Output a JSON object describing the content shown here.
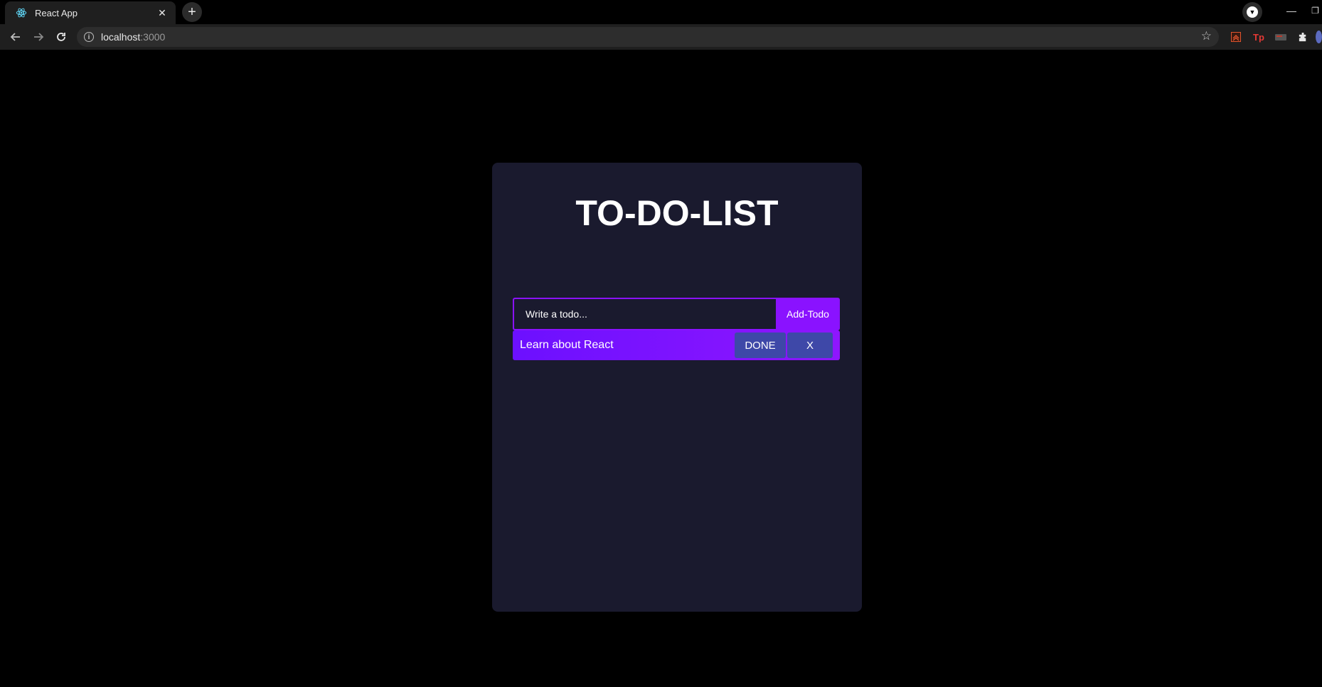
{
  "browser": {
    "tab": {
      "title": "React App",
      "close_glyph": "✕",
      "favicon": "react-logo-icon"
    },
    "new_tab_glyph": "+",
    "address": {
      "host": "localhost",
      "port": ":3000"
    },
    "window_controls": {
      "minimize": "—",
      "restore": "❐"
    }
  },
  "app": {
    "title": "TO-DO-LIST",
    "input": {
      "placeholder": "Write a todo...",
      "value": ""
    },
    "add_button": "Add-Todo",
    "todos": [
      {
        "text": "Learn about React",
        "done_label": "DONE",
        "delete_label": "X"
      }
    ]
  },
  "colors": {
    "page_bg": "#000000",
    "card_bg": "#1a1a2e",
    "accent": "#8a12ff",
    "button_bg": "#3e48a8"
  }
}
